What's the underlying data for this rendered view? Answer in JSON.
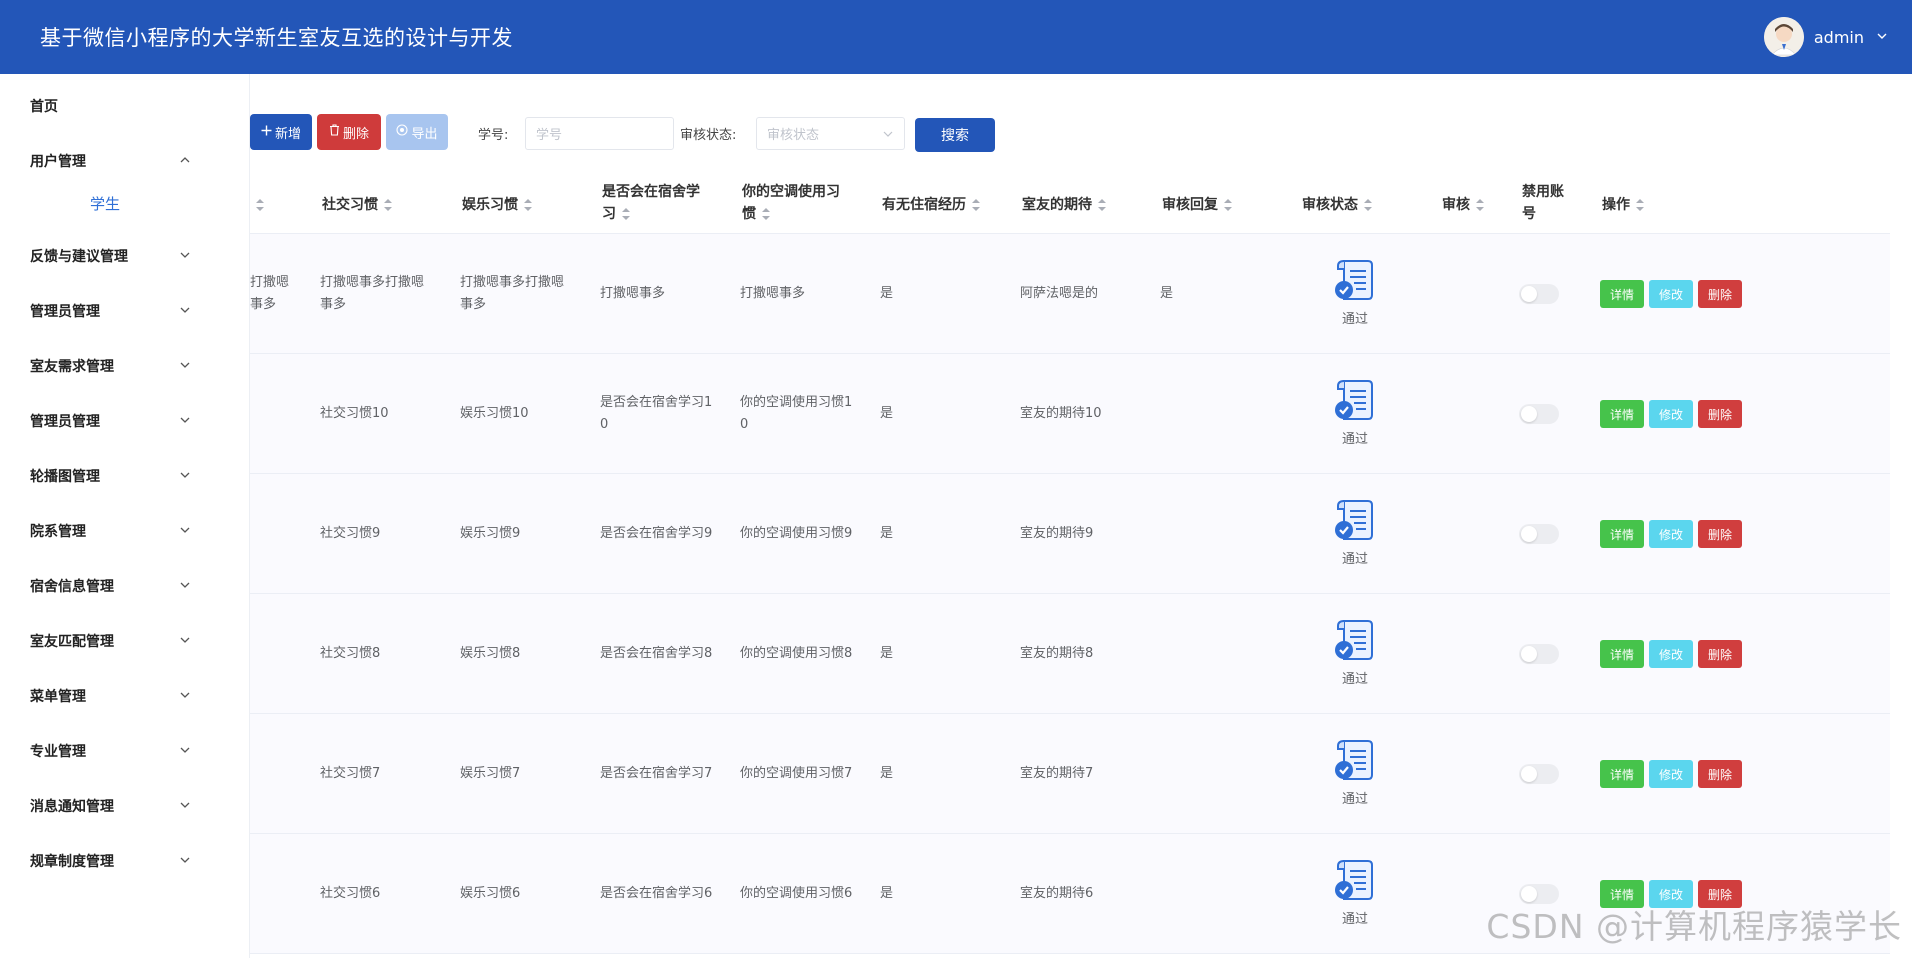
{
  "header": {
    "title": "基于微信小程序的大学新生室友互选的设计与开发",
    "username": "admin"
  },
  "sidebar": {
    "items": [
      {
        "label": "首页",
        "has_caret": false
      },
      {
        "label": "用户管理",
        "has_caret": true,
        "expanded": true
      },
      {
        "label": "反馈与建议管理",
        "has_caret": true
      },
      {
        "label": "管理员管理",
        "has_caret": true
      },
      {
        "label": "室友需求管理",
        "has_caret": true
      },
      {
        "label": "管理员管理",
        "has_caret": true
      },
      {
        "label": "轮播图管理",
        "has_caret": true
      },
      {
        "label": "院系管理",
        "has_caret": true
      },
      {
        "label": "宿舍信息管理",
        "has_caret": true
      },
      {
        "label": "室友匹配管理",
        "has_caret": true
      },
      {
        "label": "菜单管理",
        "has_caret": true
      },
      {
        "label": "专业管理",
        "has_caret": true
      },
      {
        "label": "消息通知管理",
        "has_caret": true
      },
      {
        "label": "规章制度管理",
        "has_caret": true
      }
    ],
    "sub_item": "学生"
  },
  "toolbar": {
    "add_label": "新增",
    "delete_label": "删除",
    "export_label": "导出",
    "student_no_label": "学号:",
    "student_no_placeholder": "学号",
    "status_label": "审核状态:",
    "status_placeholder": "审核状态",
    "search_label": "搜索"
  },
  "table": {
    "headers": {
      "social": "社交习惯",
      "entertainment": "娱乐习惯",
      "study_line1": "是否会在宿舍学",
      "study_line2": "习",
      "ac_line1": "你的空调使用习",
      "ac_line2": "惯",
      "dorm_exp": "有无住宿经历",
      "expect": "室友的期待",
      "reply": "审核回复",
      "status": "审核状态",
      "review": "审核",
      "disable_line1": "禁用账",
      "disable_line2": "号",
      "ops": "操作"
    },
    "rows": [
      {
        "partial_line1": "打撒嗯",
        "partial_line2": "事多",
        "social_line1": "打撒嗯事多打撒嗯",
        "social_line2": "事多",
        "ent_line1": "打撒嗯事多打撒嗯",
        "ent_line2": "事多",
        "study_line1": "打撒嗯事多",
        "study_line2": "",
        "ac_line1": "打撒嗯事多",
        "ac_line2": "",
        "dorm": "是",
        "expect": "阿萨法嗯是的",
        "reply": "是",
        "status": "通过"
      },
      {
        "partial_line1": "",
        "partial_line2": "",
        "social_line1": "社交习惯10",
        "social_line2": "",
        "ent_line1": "娱乐习惯10",
        "ent_line2": "",
        "study_line1": "是否会在宿舍学习1",
        "study_line2": "0",
        "ac_line1": "你的空调使用习惯1",
        "ac_line2": "0",
        "dorm": "是",
        "expect": "室友的期待10",
        "reply": "",
        "status": "通过"
      },
      {
        "partial_line1": "",
        "partial_line2": "",
        "social_line1": "社交习惯9",
        "social_line2": "",
        "ent_line1": "娱乐习惯9",
        "ent_line2": "",
        "study_line1": "是否会在宿舍学习9",
        "study_line2": "",
        "ac_line1": "你的空调使用习惯9",
        "ac_line2": "",
        "dorm": "是",
        "expect": "室友的期待9",
        "reply": "",
        "status": "通过"
      },
      {
        "partial_line1": "",
        "partial_line2": "",
        "social_line1": "社交习惯8",
        "social_line2": "",
        "ent_line1": "娱乐习惯8",
        "ent_line2": "",
        "study_line1": "是否会在宿舍学习8",
        "study_line2": "",
        "ac_line1": "你的空调使用习惯8",
        "ac_line2": "",
        "dorm": "是",
        "expect": "室友的期待8",
        "reply": "",
        "status": "通过"
      },
      {
        "partial_line1": "",
        "partial_line2": "",
        "social_line1": "社交习惯7",
        "social_line2": "",
        "ent_line1": "娱乐习惯7",
        "ent_line2": "",
        "study_line1": "是否会在宿舍学习7",
        "study_line2": "",
        "ac_line1": "你的空调使用习惯7",
        "ac_line2": "",
        "dorm": "是",
        "expect": "室友的期待7",
        "reply": "",
        "status": "通过"
      },
      {
        "partial_line1": "",
        "partial_line2": "",
        "social_line1": "社交习惯6",
        "social_line2": "",
        "ent_line1": "娱乐习惯6",
        "ent_line2": "",
        "study_line1": "是否会在宿舍学习6",
        "study_line2": "",
        "ac_line1": "你的空调使用习惯6",
        "ac_line2": "",
        "dorm": "是",
        "expect": "室友的期待6",
        "reply": "",
        "status": "通过"
      }
    ],
    "actions": {
      "detail": "详情",
      "edit": "修改",
      "delete": "删除"
    }
  },
  "watermark": "CSDN @计算机程序猿学长",
  "colors": {
    "header_bg": "#2356b8",
    "primary": "#2356b8",
    "danger": "#cf3b3b",
    "success": "#46c34b",
    "info": "#5bd6ee",
    "link": "#2f6fd6"
  },
  "icons": {
    "add": "plus-icon",
    "delete": "trash-icon",
    "export": "export-icon",
    "status": "approved-document-icon",
    "caret": "chevron-down-icon"
  }
}
